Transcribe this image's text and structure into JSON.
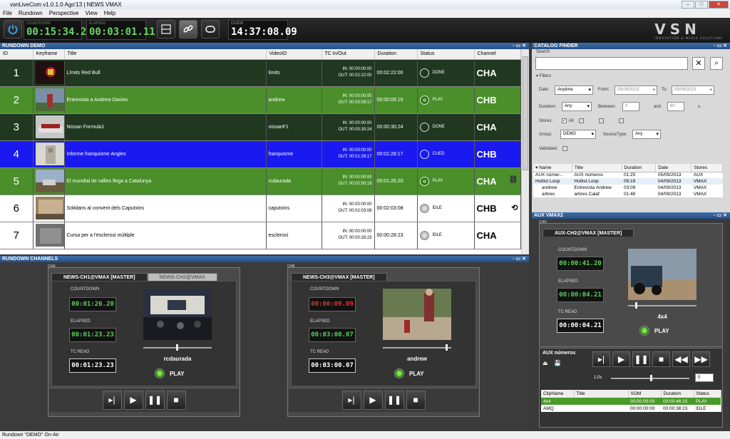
{
  "window": {
    "title": "vsnLiveCom v1.0.1.0 Ago'13  |  NEWS VMAX"
  },
  "menu": [
    "File",
    "Rundown",
    "Perspective",
    "View",
    "Help"
  ],
  "toolbar": {
    "countdown_label": "COUNTDOWN",
    "countdown": "00:15:34.21",
    "elapsed_label": "ELAPSED",
    "elapsed": "00:03:01.11",
    "clock_label": "CLOCK",
    "clock": "14:37:08.09",
    "logo": "VSN",
    "logo_tagline": "INNOVATION & MEDIA SOLUTIONS"
  },
  "rundown": {
    "title": "RUNDOWN DEMO",
    "columns": [
      "ID",
      "Keyframe",
      "Title",
      "VideoID",
      "TC In/Out",
      "Duration",
      "Status",
      "Channel"
    ],
    "rows": [
      {
        "id": "1",
        "title": "Límits Red Bull",
        "video": "limits",
        "tcin": "IN: 00:00:00:00",
        "tcout": "OUT: 00:02:22:00",
        "dur": "00:02:22:00",
        "status": "DONE",
        "channel": "CHA"
      },
      {
        "id": "2",
        "title": "Entrevista a Andrew Davies",
        "video": "andrew",
        "tcin": "IN: 00:00:00:00",
        "tcout": "OUT: 00:03:09:17",
        "dur": "00:00:09.15",
        "status": "PLAY",
        "channel": "CHB"
      },
      {
        "id": "3",
        "title": "Nissan Formula1",
        "video": "nissanF1",
        "tcin": "IN: 00:00:00:00",
        "tcout": "OUT: 00:00:30:24",
        "dur": "00:00:30:24",
        "status": "DONE",
        "channel": "CHA"
      },
      {
        "id": "4",
        "title": "Informe franquisme Angles",
        "video": "franquisme",
        "tcin": "IN: 00:00:00:00",
        "tcout": "OUT: 00:01:28:17",
        "dur": "00:01:28:17",
        "status": "CUED",
        "channel": "CHB"
      },
      {
        "id": "5",
        "title": "El mundial de rallies llega a Catalunya",
        "video": "rcdaurada",
        "tcin": "IN: 00:00:00:00",
        "tcout": "OUT: 00:02:50:19",
        "dur": "00:01:26.20",
        "status": "PLAY",
        "channel": "CHA"
      },
      {
        "id": "6",
        "title": "Solidaris al convent dels Caputxins",
        "video": "caputxins",
        "tcin": "IN: 00:00:00:00",
        "tcout": "OUT: 00:02:03:08",
        "dur": "00:02:03:08",
        "status": "IDLE",
        "channel": "CHB"
      },
      {
        "id": "7",
        "title": "Cursa per a l'esclerosi múltiple",
        "video": "esclerosi",
        "tcin": "IN: 00:00:00:00",
        "tcout": "OUT: 00:00:28:23",
        "dur": "00:00:28:23",
        "status": "IDLE",
        "channel": "CHA"
      }
    ]
  },
  "channels": {
    "title": "RUNDOWN CHANNELS",
    "cha": {
      "group": "CHA",
      "tab1": "NEWS-CH1@VMAX  [MASTER]",
      "tab2": "NEWS-CH2@VMAX",
      "countdown_label": "COUNTDOWN",
      "countdown": "00:01:26.20",
      "elapsed_label": "ELAPSED",
      "elapsed": "00:01:23.23",
      "tcread_label": "TC READ",
      "tcread": "00:01:23.23",
      "clip": "rcdaurada",
      "state": "PLAY"
    },
    "chb": {
      "group": "CHB",
      "tab1": "NEWS-CH3@VMAX  [MASTER]",
      "countdown_label": "COUNTDOWN",
      "countdown": "00:00:09.09",
      "elapsed_label": "ELAPSED",
      "elapsed": "00:03:00.07",
      "tcread_label": "TC READ",
      "tcread": "00:03:00.07",
      "clip": "andrew",
      "state": "PLAY"
    }
  },
  "catalog": {
    "title": "CATALOG FINDER",
    "search_label": "Search",
    "filters_label": "Filters",
    "date_label": "Date:",
    "date_value": "Anytime",
    "from_label": "From:",
    "from_value": "05/09/2013",
    "to_label": "To:",
    "to_value": "05/09/2013",
    "duration_label": "Duration:",
    "duration_value": "Any",
    "between_label": "Between:",
    "between_from": "0",
    "and_label": "and",
    "between_to": "60",
    "sec_label": "s.",
    "stores_label": "Stores:",
    "stores_all": "All",
    "group_label": "Group:",
    "group_value": "DEMO",
    "sourcetype_label": "SourceType:",
    "sourcetype_value": "Any",
    "validated_label": "Validated:",
    "columns": [
      "Name",
      "Title",
      "Duration",
      "Date",
      "Stores"
    ],
    "rows": [
      {
        "name": "AUX númer...",
        "title": "AUX números",
        "dur": "01:25",
        "date": "05/09/2013",
        "store": "AUX"
      },
      {
        "name": "Hotlist Loop",
        "title": "Hotlist Loop",
        "dur": "09:19",
        "date": "04/09/2013",
        "store": "VMAX"
      },
      {
        "name": "andrew",
        "title": "Entrevista Andrew",
        "dur": "03:09",
        "date": "04/09/2013",
        "store": "VMAX"
      },
      {
        "name": "arbres",
        "title": "arbres Calaf",
        "dur": "01:48",
        "date": "04/09/2013",
        "store": "VMAX"
      }
    ]
  },
  "aux": {
    "title": "AUX VMAX2",
    "group": "CHD",
    "tab": "AUX-CH2@VMAX  [MASTER]",
    "countdown_label": "COUNTDOWN",
    "countdown": "00:00:41.20",
    "elapsed_label": "ELAPSED",
    "elapsed": "00:00:04.21",
    "tcread_label": "TC READ",
    "tcread": "00:00:04.21",
    "clip": "4x4",
    "state": "PLAY",
    "playlist_title": "AUX números",
    "speed": "1,0x",
    "speed_box": "0",
    "columns": [
      "ClipName",
      "Title",
      "SOM",
      "Duration",
      "Status"
    ],
    "rows": [
      {
        "clip": "4x4",
        "title": "",
        "som": "00:00:00:00",
        "dur": "00:00:46:15",
        "status": "PLAY"
      },
      {
        "clip": "AMQ",
        "title": "",
        "som": "00:00:00:00",
        "dur": "00:00:38:23",
        "status": "IDLE"
      }
    ]
  },
  "statusbar": {
    "text": "Rundown \"DEMO\" On-Air"
  },
  "colors": {
    "play_green": "#4a8f2a",
    "done_green": "#203820",
    "cued_blue": "#1a1af0",
    "panel_header": "#2f5d96",
    "counter_green": "#6bd36b",
    "counter_red": "#e03030"
  }
}
